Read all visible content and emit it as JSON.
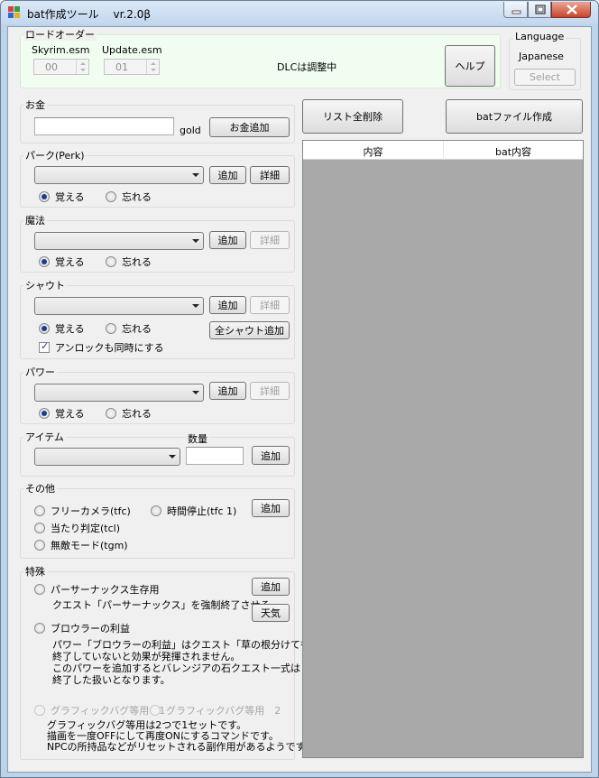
{
  "window": {
    "title": "bat作成ツール　 vr.2.0β"
  },
  "load_order": {
    "label": "ロードオーダー",
    "skyrim_label": "Skyrim.esm",
    "skyrim_value": "00",
    "update_label": "Update.esm",
    "update_value": "01",
    "dlc_note": "DLCは調整中",
    "help_button": "ヘルプ"
  },
  "language": {
    "label": "Language",
    "value": "Japanese",
    "select_button": "Select"
  },
  "gold": {
    "label": "お金",
    "input_value": "",
    "unit": "gold",
    "add_button": "お金追加"
  },
  "perk": {
    "label": "パーク(Perk)",
    "add_button": "追加",
    "detail_button": "詳細",
    "learn": "覚える",
    "forget": "忘れる"
  },
  "magic": {
    "label": "魔法",
    "add_button": "追加",
    "detail_button": "詳細",
    "learn": "覚える",
    "forget": "忘れる"
  },
  "shout": {
    "label": "シャウト",
    "add_button": "追加",
    "detail_button": "詳細",
    "learn": "覚える",
    "forget": "忘れる",
    "all_shout_button": "全シャウト追加",
    "unlock_check": "アンロックも同時にする"
  },
  "power": {
    "label": "パワー",
    "add_button": "追加",
    "detail_button": "詳細",
    "learn": "覚える",
    "forget": "忘れる"
  },
  "item": {
    "label": "アイテム",
    "quantity_label": "数量",
    "quantity_value": "",
    "add_button": "追加"
  },
  "other": {
    "label": "その他",
    "free_camera": "フリーカメラ(tfc)",
    "time_stop": "時間停止(tfc 1)",
    "collision": "当たり判定(tcl)",
    "god_mode": "無敵モード(tgm)",
    "add_button": "追加"
  },
  "special": {
    "label": "特殊",
    "paarthurnax": "パーサーナックス生存用",
    "paarthurnax_desc": "クエスト「パーサーナックス」を強制終了させる。",
    "add_button": "追加",
    "weather_button": "天気",
    "brawler": "ブロウラーの利益",
    "brawler_desc": "パワー「ブロウラーの利益」はクエスト「草の根分けても」が\n終了していないと効果が発揮されません。\nこのパワーを追加するとバレンジアの石クエスト一式は\n終了した扱いとなります。",
    "graphic_bug_1": "グラフィックバグ等用　1",
    "graphic_bug_2": "グラフィックバグ等用　2",
    "graphic_desc": "グラフィックバグ等用は2つで1セットです。\n描画を一度OFFにして再度ONにするコマンドです。\nNPCの所持品などがリセットされる副作用があるようです。"
  },
  "toolbar": {
    "clear_all_button": "リスト全削除",
    "create_bat_button": "batファイル作成"
  },
  "list": {
    "columns": [
      "内容",
      "bat内容"
    ]
  },
  "colors": {
    "load_order_bg": "#f0fdf0",
    "list_bg": "#a9a9a9",
    "radio_dot": "#1e3c8c"
  }
}
